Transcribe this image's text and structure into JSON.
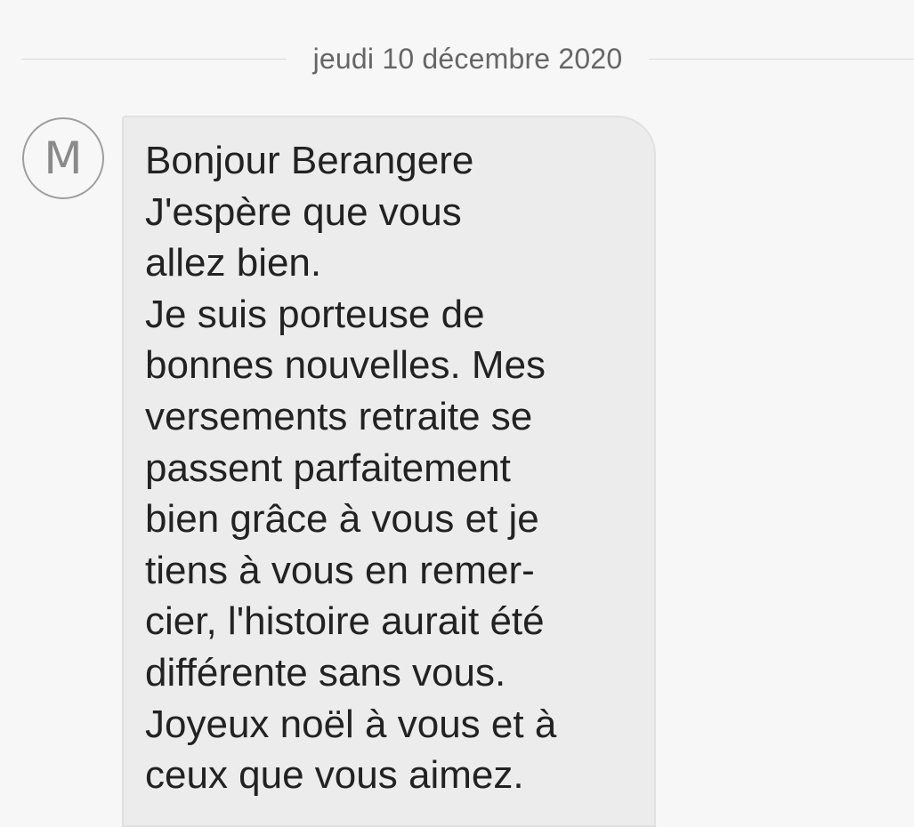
{
  "conversation": {
    "date_separator": "jeudi 10 décembre 2020",
    "messages": [
      {
        "sender_initial": "M",
        "lines": [
          "Bonjour Berangere",
          "J'espère que vous",
          "allez bien.",
          "Je suis porteuse de",
          "bonnes nouvelles. Mes",
          "versements retraite se",
          "passent parfaitement",
          "bien grâce à vous et je",
          "tiens à vous en remer-",
          "cier, l'histoire aurait été",
          "différente sans vous.",
          "Joyeux noël à vous et à",
          "ceux que vous aimez."
        ]
      }
    ]
  }
}
